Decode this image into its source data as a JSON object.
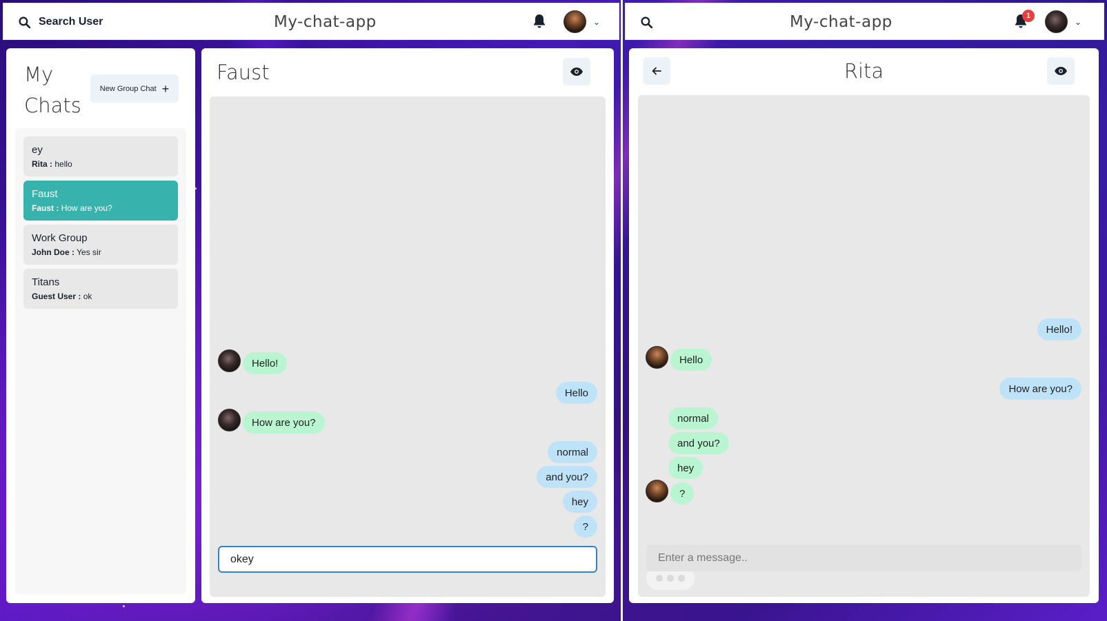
{
  "app": {
    "brand": "My-chat-app"
  },
  "left": {
    "topbar": {
      "search_label": "Search User"
    },
    "chats_panel": {
      "title": "My Chats",
      "new_group_label": "New Group Chat",
      "chats": [
        {
          "name": "ey",
          "sender": "Rita :",
          "preview": "hello",
          "selected": false
        },
        {
          "name": "Faust",
          "sender": "Faust :",
          "preview": "How are you?",
          "selected": true
        },
        {
          "name": "Work Group",
          "sender": "John Doe :",
          "preview": "Yes sir",
          "selected": false
        },
        {
          "name": "Titans",
          "sender": "Guest User :",
          "preview": "ok",
          "selected": false
        }
      ]
    },
    "chat": {
      "title": "Faust",
      "messages": [
        {
          "text": "Hello!",
          "from": "them",
          "avatar": true
        },
        {
          "text": "Hello",
          "from": "me"
        },
        {
          "text": "How are you?",
          "from": "them",
          "avatar": true
        },
        {
          "text": "normal",
          "from": "me"
        },
        {
          "text": "and you?",
          "from": "me"
        },
        {
          "text": "hey",
          "from": "me"
        },
        {
          "text": "?",
          "from": "me"
        }
      ],
      "input_value": "okey"
    }
  },
  "right": {
    "topbar": {
      "notification_count": "1"
    },
    "chat": {
      "title": "Rita",
      "messages": [
        {
          "text": "Hello!",
          "from": "me"
        },
        {
          "text": "Hello",
          "from": "them",
          "avatar": true
        },
        {
          "text": "How are you?",
          "from": "me"
        },
        {
          "text": "normal",
          "from": "them"
        },
        {
          "text": "and you?",
          "from": "them"
        },
        {
          "text": "hey",
          "from": "them"
        },
        {
          "text": "?",
          "from": "them",
          "avatar": true
        }
      ],
      "input_placeholder": "Enter a message.."
    }
  },
  "colors": {
    "selected_chat": "#38b2ac",
    "their_bubble": "#b9f5d0",
    "my_bubble": "#bee3f8",
    "badge": "#e53e3e",
    "input_focus": "#3182ce"
  },
  "icons": [
    "search-icon",
    "bell-icon",
    "chevron-down-icon",
    "plus-icon",
    "eye-icon",
    "arrow-left-icon"
  ]
}
